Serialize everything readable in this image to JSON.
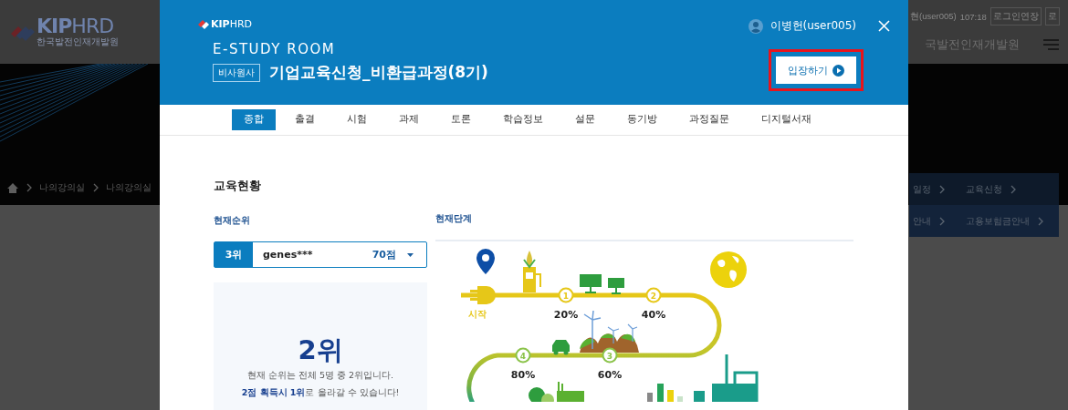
{
  "site": {
    "logo": {
      "brand": "**KIP**HRD",
      "subtitle": "한국발전인재개발원"
    },
    "user": "현(user005)",
    "timer": "107:18",
    "buttons": [
      "로그인연장",
      "로"
    ],
    "org_name": "국발전인재개발원",
    "breadcrumb": [
      "나의강의실",
      "나의강의실"
    ],
    "quick_menu": [
      {
        "label": "일정"
      },
      {
        "label": "교육신청"
      },
      {
        "label": "안내"
      },
      {
        "label": "고용보험금안내"
      }
    ]
  },
  "modal": {
    "brand": "**KIP**HRD",
    "user": "이병헌(user005)",
    "title": "E-STUDY ROOM",
    "badge": "비사원사",
    "course": "기업교육신청_비환급과정(8기)",
    "enter_button": {
      "label": "입장하기",
      "highlighted": true
    },
    "tabs": [
      {
        "label": "종합",
        "selected": true
      },
      {
        "label": "출결",
        "selected": false
      },
      {
        "label": "시험",
        "selected": false
      },
      {
        "label": "과제",
        "selected": false
      },
      {
        "label": "토론",
        "selected": false
      },
      {
        "label": "학습정보",
        "selected": false
      },
      {
        "label": "설문",
        "selected": false
      },
      {
        "label": "동기방",
        "selected": false
      },
      {
        "label": "과정질문",
        "selected": false
      },
      {
        "label": "디지털서재",
        "selected": false
      }
    ]
  },
  "overview": {
    "heading": "교육현황",
    "rank_label": "현재순위",
    "rank_select": {
      "rank": "3위",
      "name": "genes***",
      "score": "70점"
    },
    "my_rank": "2위",
    "summary": "현재 순위는 전체 5명 중 2위입니다.",
    "hint": "**2점 획득시 1위**로 올라갈 수 있습니다!"
  },
  "stage": {
    "label": "현재단계",
    "start": "시작",
    "steps": [
      {
        "number": "1",
        "percent": "20%"
      },
      {
        "number": "2",
        "percent": "40%"
      },
      {
        "number": "4",
        "percent": "80%"
      },
      {
        "number": "3",
        "percent": "60%"
      }
    ]
  }
}
